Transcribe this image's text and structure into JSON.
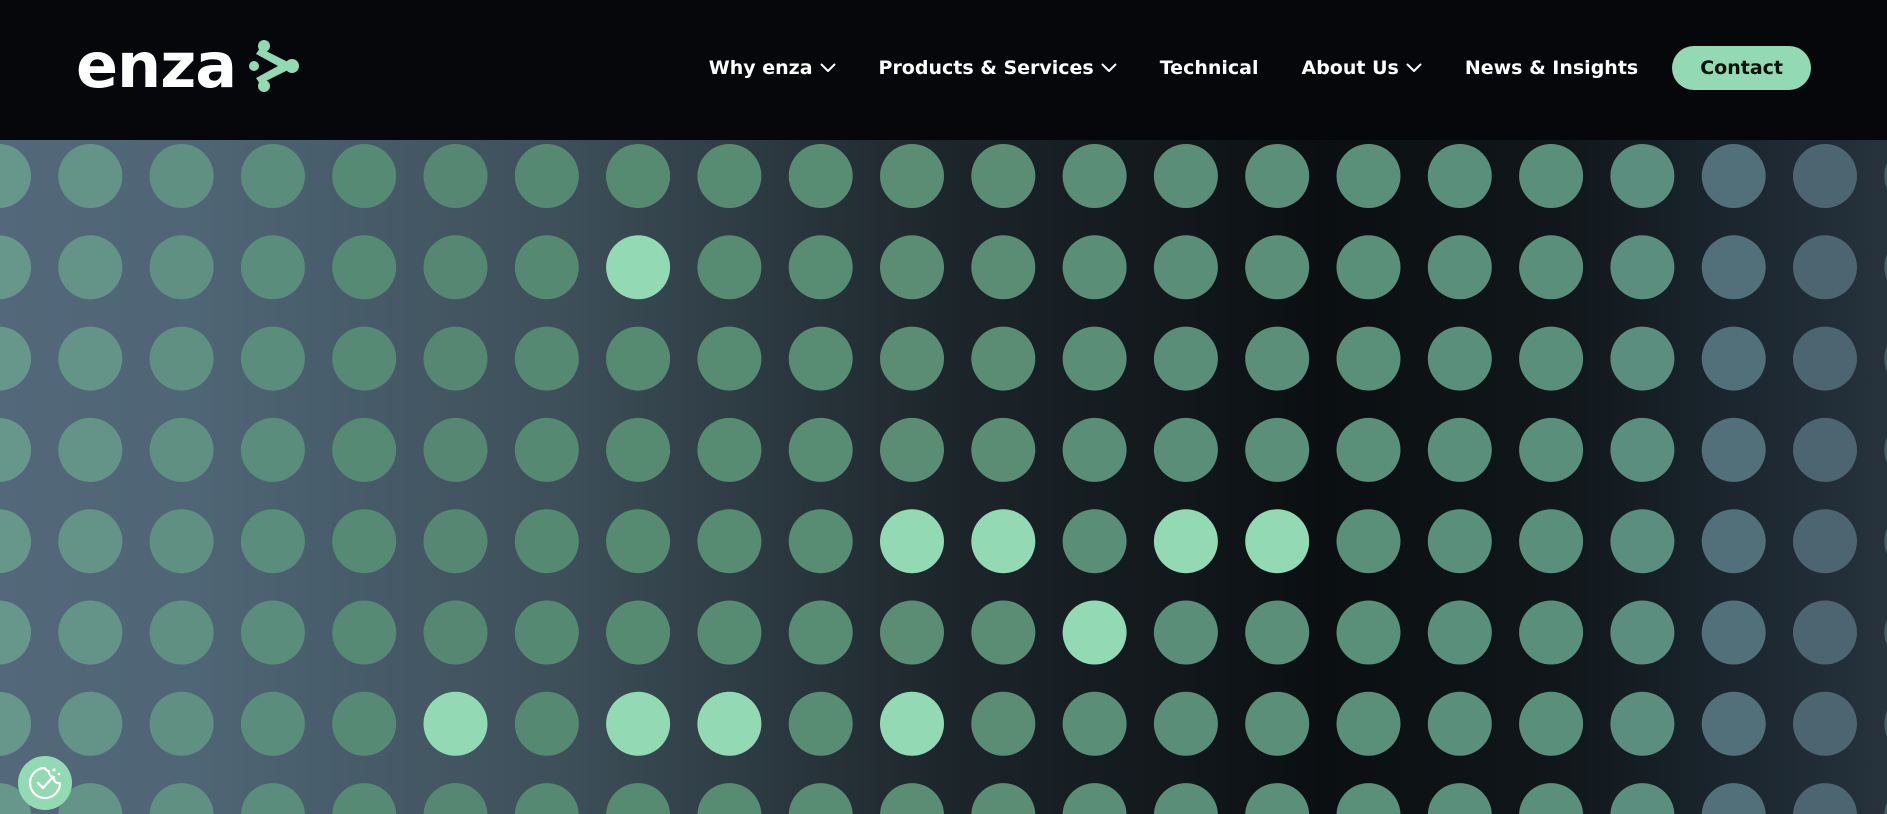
{
  "brand": {
    "name": "enza",
    "accent_color": "#93d9b3",
    "header_bg": "#05070a"
  },
  "nav": {
    "items": [
      {
        "label": "Why enza",
        "dropdown": true
      },
      {
        "label": "Products & Services",
        "dropdown": true
      },
      {
        "label": "Technical",
        "dropdown": false
      },
      {
        "label": "About Us",
        "dropdown": true
      },
      {
        "label": "News & Insights",
        "dropdown": false
      }
    ],
    "cta_label": "Contact"
  },
  "hero": {
    "pattern": "dot-grid",
    "rows": 8,
    "cols": 21,
    "highlight_color": "#93d9b3",
    "highlighted_dots": [
      [
        1,
        7
      ],
      [
        4,
        10
      ],
      [
        4,
        11
      ],
      [
        4,
        13
      ],
      [
        4,
        14
      ],
      [
        5,
        12
      ],
      [
        6,
        5
      ],
      [
        6,
        7
      ],
      [
        6,
        8
      ],
      [
        6,
        10
      ]
    ]
  },
  "cookie_widget": {
    "icon": "cookie-consent-icon"
  }
}
